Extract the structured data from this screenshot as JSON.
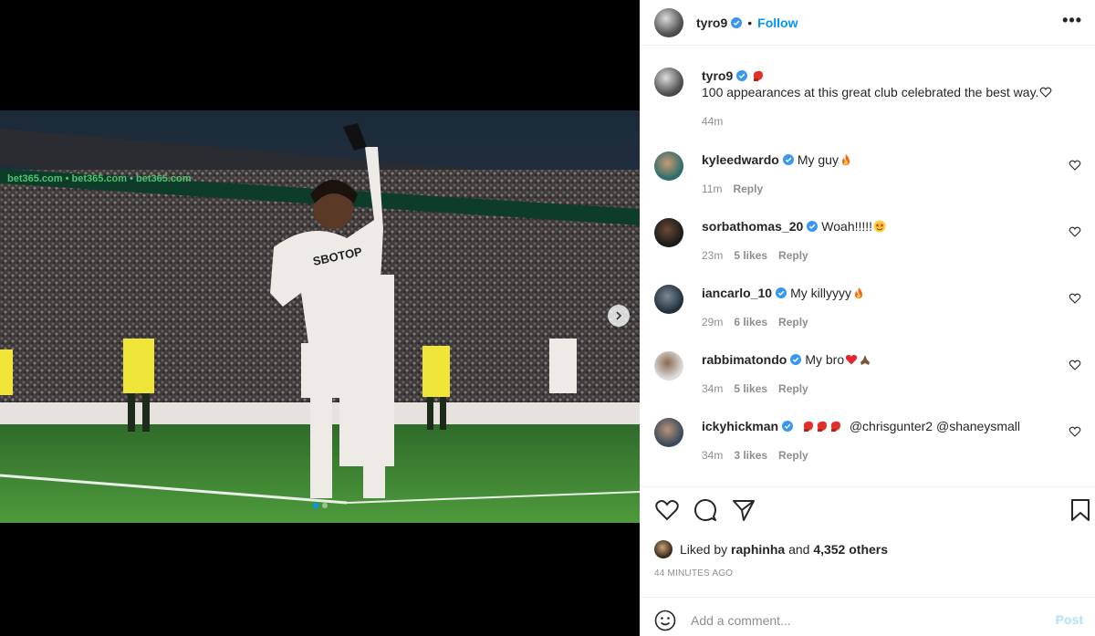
{
  "post": {
    "author": "tyro9",
    "follow_label": "Follow",
    "separator": "•",
    "more_label": "•••"
  },
  "caption": {
    "username": "tyro9",
    "text": "100 appearances at this great club celebrated the best way.",
    "time": "44m"
  },
  "comments": [
    {
      "username": "kyleedwardo",
      "text": "My guy",
      "emoji": "fire-emoji",
      "time": "11m",
      "likes": "",
      "reply_label": "Reply"
    },
    {
      "username": "sorbathomas_20",
      "text": "Woah!!!!!",
      "emoji": "star-eyes-emoji",
      "time": "23m",
      "likes": "5 likes",
      "reply_label": "Reply"
    },
    {
      "username": "iancarlo_10",
      "text": "My killyyyy",
      "emoji": "fire-emoji",
      "time": "29m",
      "likes": "6 likes",
      "reply_label": "Reply"
    },
    {
      "username": "rabbimatondo",
      "text": "My bro",
      "emoji": "heart-pray-emoji",
      "time": "34m",
      "likes": "5 likes",
      "reply_label": "Reply"
    },
    {
      "username": "ickyhickman",
      "text": "",
      "mentions": "@chrisgunter2 @shaneysmall",
      "emoji": "boxing-glove-emoji",
      "time": "34m",
      "likes": "3 likes",
      "reply_label": "Reply"
    }
  ],
  "likes_line": {
    "prefix": "Liked by",
    "user": "raphinha",
    "and": "and",
    "others": "4,352 others"
  },
  "timestamp": "44 MINUTES AGO",
  "comment_box": {
    "placeholder": "Add a comment...",
    "post_label": "Post"
  },
  "carousel": {
    "slides": 2,
    "active_index": 0
  },
  "colors": {
    "accent": "#0095f6",
    "post_disabled": "#b2dffc",
    "muted": "#8e8e8e"
  }
}
